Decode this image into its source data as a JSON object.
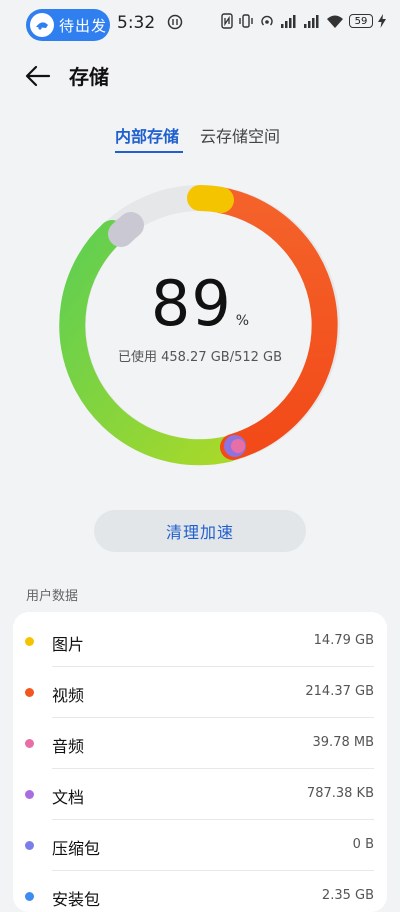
{
  "status": {
    "pill_text": "待出发",
    "time": "5:32",
    "battery": "59"
  },
  "header": {
    "title": "存储"
  },
  "tabs": {
    "internal": "内部存储",
    "cloud": "云存储空间"
  },
  "usage": {
    "percent": "89",
    "percent_sign": "%",
    "used_text": "已使用 458.27 GB/512 GB",
    "fraction_used": 0.89
  },
  "clean_button": "清理加速",
  "section_label": "用户数据",
  "items": [
    {
      "name": "图片",
      "size": "14.79 GB",
      "color": "#f5c400"
    },
    {
      "name": "视频",
      "size": "214.37 GB",
      "color": "#f2571f"
    },
    {
      "name": "音频",
      "size": "39.78 MB",
      "color": "#e86fa6"
    },
    {
      "name": "文档",
      "size": "787.38 KB",
      "color": "#a86ee0"
    },
    {
      "name": "压缩包",
      "size": "0 B",
      "color": "#7a7ee6"
    },
    {
      "name": "安装包",
      "size": "2.35 GB",
      "color": "#3d8cf0"
    }
  ],
  "colors": {
    "accent": "#1f5fcf",
    "pill": "#2f7ff0"
  }
}
